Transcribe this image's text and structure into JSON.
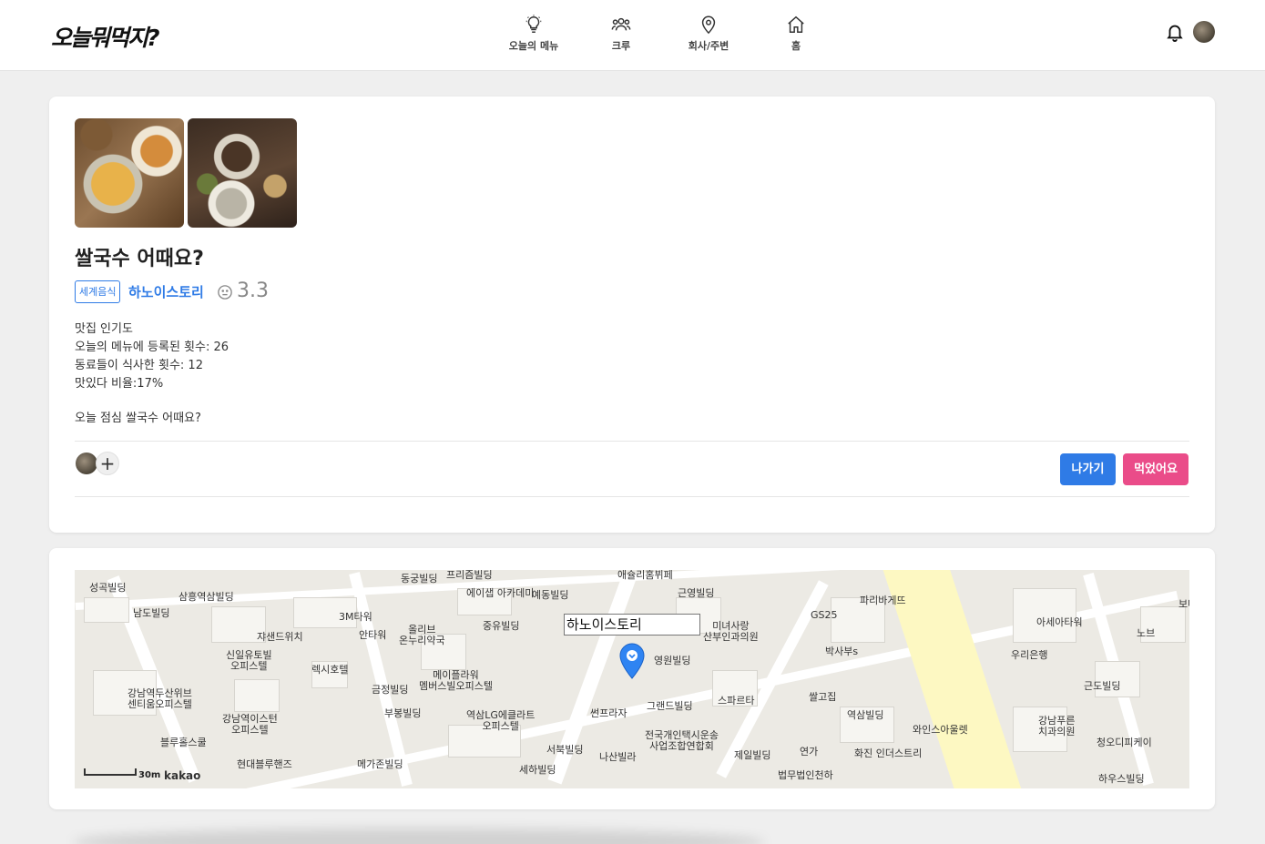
{
  "app": {
    "logo": "오늘뭐먹지?"
  },
  "nav": [
    {
      "label": "오늘의 메뉴",
      "icon": "lightbulb-icon"
    },
    {
      "label": "크루",
      "icon": "group-icon"
    },
    {
      "label": "회사/주변",
      "icon": "location-pin-icon"
    },
    {
      "label": "홈",
      "icon": "home-icon"
    }
  ],
  "post": {
    "title": "쌀국수 어때요?",
    "category": "세계음식",
    "restaurant": "하노이스토리",
    "rating": "3.3",
    "stats_heading": "맛집 인기도",
    "stat_registered": "오늘의 메뉴에 등록된 횟수: 26",
    "stat_eaten": "동료들이 식사한 횟수: 12",
    "stat_ratio": "맛있다 비율:17%",
    "description": "오늘 점심 쌀국수 어때요?",
    "add_member": "+"
  },
  "actions": {
    "leave": "나가기",
    "ate": "먹었어요"
  },
  "map": {
    "infobox": "하노이스토리",
    "scale": "30m",
    "provider": "kakao",
    "labels": [
      "성곡빌딩",
      "삼흥역삼빌딩",
      "남도빌딩",
      "쟈샌드위치",
      "신일유토빌 오피스텔",
      "강남역두산위브 센티움오피스텔",
      "강남역이스턴 오피스텔",
      "블루홀스쿨",
      "현대블루핸즈",
      "3M타워",
      "안타워",
      "렉시호텔",
      "동궁빌딩",
      "프리즘빌딩",
      "에이샙 아카데미",
      "올리브 온누리약국",
      "중유빌딩",
      "메이플라워 멤버스빌오피스텔",
      "금정빌딩",
      "부봉빌딩",
      "역삼LG에클라트 오피스텔",
      "메가존빌딩",
      "서북빌딩",
      "세하빌딩",
      "예동빌딩",
      "애슐리홈뷔페",
      "근영빌딩",
      "미녀사랑 산부인과의원",
      "영원빌딩",
      "썬프라자",
      "그랜드빌딩",
      "스파르타",
      "나산빌라",
      "전국개인택시운송 사업조합연합회",
      "제일빌딩",
      "연가",
      "법무법인천하",
      "GS25",
      "박사부s",
      "파리바게뜨",
      "쌀고집",
      "역삼빌딩",
      "와인스아울렛",
      "화진 인더스트리",
      "아세아타워",
      "우리은행",
      "근도빌딩",
      "강남푸른 치과의원",
      "청오디피케이",
      "하우스빌딩",
      "보나비",
      "노브"
    ]
  }
}
